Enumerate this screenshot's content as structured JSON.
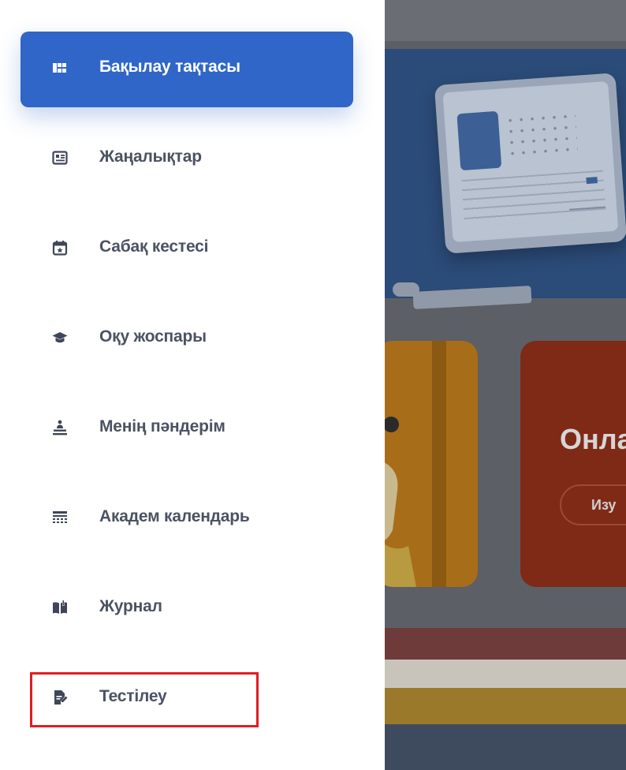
{
  "sidebar": {
    "items": [
      {
        "label": "Бақылау тақтасы",
        "icon": "dashboard-icon",
        "active": true
      },
      {
        "label": "Жаңалықтар",
        "icon": "newspaper-icon"
      },
      {
        "label": "Сабақ кестесі",
        "icon": "calendar-star-icon"
      },
      {
        "label": "Оқу жоспары",
        "icon": "graduation-cap-icon"
      },
      {
        "label": "Менің пәндерім",
        "icon": "person-at-desk-icon"
      },
      {
        "label": "Академ календарь",
        "icon": "calendar-grid-icon"
      },
      {
        "label": "Журнал",
        "icon": "open-book-icon"
      },
      {
        "label": "Тестілеу",
        "icon": "test-document-icon",
        "highlighted": true
      }
    ]
  },
  "background": {
    "promo_title": "Онла",
    "promo_button": "Изу"
  },
  "colors": {
    "active_bg": "#2f66c8",
    "highlight_border": "#e11d22",
    "label_text": "#4b5263",
    "icon_color": "#3e4657"
  }
}
